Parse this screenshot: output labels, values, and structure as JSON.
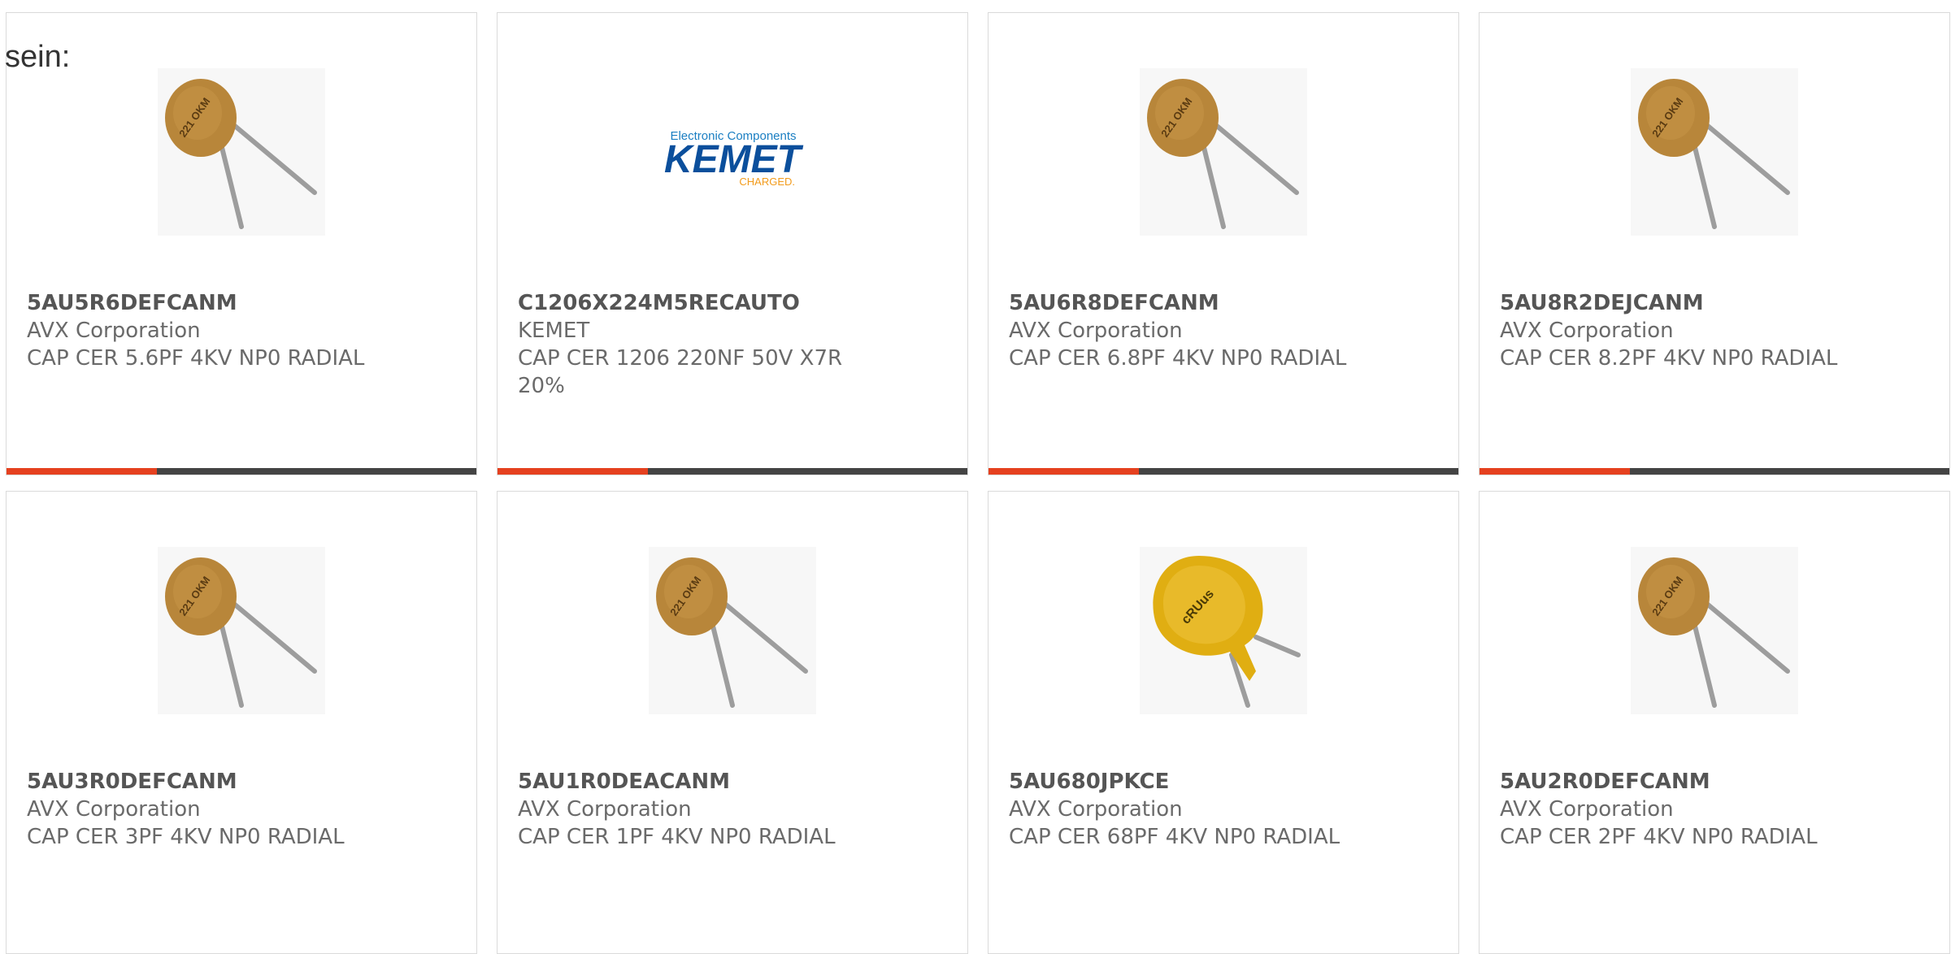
{
  "intro": {
    "text": "sein:"
  },
  "products": [
    {
      "part": "5AU5R6DEFCANM",
      "manufacturer": "AVX Corporation",
      "description": "CAP CER 5.6PF 4KV NP0 RADIAL",
      "image": "disc-capacitor-brown-icon",
      "marking": "221 OKM"
    },
    {
      "part": "C1206X224M5RECAUTO",
      "manufacturer": "KEMET",
      "description": "CAP CER 1206 220NF 50V X7R 20%",
      "image": "kemet-logo",
      "logo_top": "Electronic Components",
      "logo_main": "KEMET",
      "logo_sub": "CHARGED."
    },
    {
      "part": "5AU6R8DEFCANM",
      "manufacturer": "AVX Corporation",
      "description": "CAP CER 6.8PF 4KV NP0 RADIAL",
      "image": "disc-capacitor-brown-icon",
      "marking": "221 OKM"
    },
    {
      "part": "5AU8R2DEJCANM",
      "manufacturer": "AVX Corporation",
      "description": "CAP CER 8.2PF 4KV NP0 RADIAL",
      "image": "disc-capacitor-brown-icon",
      "marking": "221 OKM"
    },
    {
      "part": "5AU3R0DEFCANM",
      "manufacturer": "AVX Corporation",
      "description": "CAP CER 3PF 4KV NP0 RADIAL",
      "image": "disc-capacitor-brown-icon",
      "marking": "221 OKM"
    },
    {
      "part": "5AU1R0DEACANM",
      "manufacturer": "AVX Corporation",
      "description": "CAP CER 1PF 4KV NP0 RADIAL",
      "image": "disc-capacitor-brown-icon",
      "marking": "221 OKM"
    },
    {
      "part": "5AU680JPKCE",
      "manufacturer": "AVX Corporation",
      "description": "CAP CER 68PF 4KV NP0 RADIAL",
      "image": "disc-capacitor-yellow-icon",
      "marking": "cRUus"
    },
    {
      "part": "5AU2R0DEFCANM",
      "manufacturer": "AVX Corporation",
      "description": "CAP CER 2PF 4KV NP0 RADIAL",
      "image": "disc-capacitor-brown-icon",
      "marking": "221 OKM"
    }
  ],
  "colors": {
    "accent": "#e5411f",
    "bar": "#444444",
    "border": "#dadada",
    "capacitor_brown": "#b8863a",
    "capacitor_yellow": "#e0ae12",
    "kemet_blue": "#0b4f9c",
    "kemet_orange": "#f29b1b"
  }
}
